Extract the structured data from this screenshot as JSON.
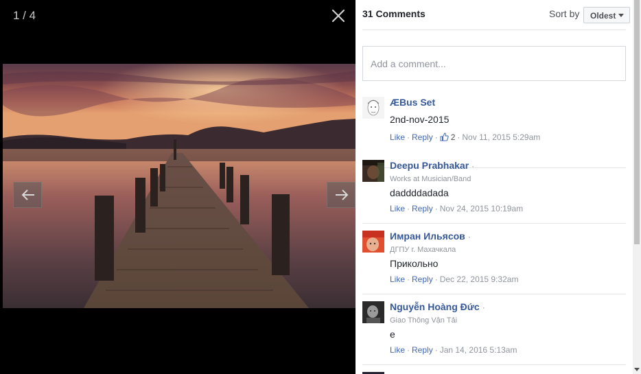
{
  "viewer": {
    "counter": "1 / 4"
  },
  "panel": {
    "comment_count": "31 Comments",
    "sort_label": "Sort by",
    "sort_value": "Oldest",
    "comment_placeholder": "Add a comment..."
  },
  "comments": [
    {
      "author": "ÆBus Set",
      "subtitle": "",
      "text": "2nd-nov-2015",
      "like": "Like",
      "reply": "Reply",
      "likes": "2",
      "timestamp": "Nov 11, 2015 5:29am"
    },
    {
      "author": "Deepu Prabhakar",
      "subtitle": "Works at Musician/Band",
      "text": "daddddadada",
      "like": "Like",
      "reply": "Reply",
      "timestamp": "Nov 24, 2015 10:19am"
    },
    {
      "author": "Имран Ильясов",
      "subtitle": "ДГПУ г. Махачкала",
      "text": "Прикольно",
      "like": "Like",
      "reply": "Reply",
      "timestamp": "Dec 22, 2015 9:32am"
    },
    {
      "author": "Nguyễn Hoàng Đức",
      "subtitle": "Giao Thông Vận Tải",
      "text": "e",
      "like": "Like",
      "reply": "Reply",
      "timestamp": "Jan 14, 2016 5:13am"
    }
  ],
  "colors": {
    "link": "#365899",
    "action": "#4267b2",
    "muted": "#90949c"
  }
}
